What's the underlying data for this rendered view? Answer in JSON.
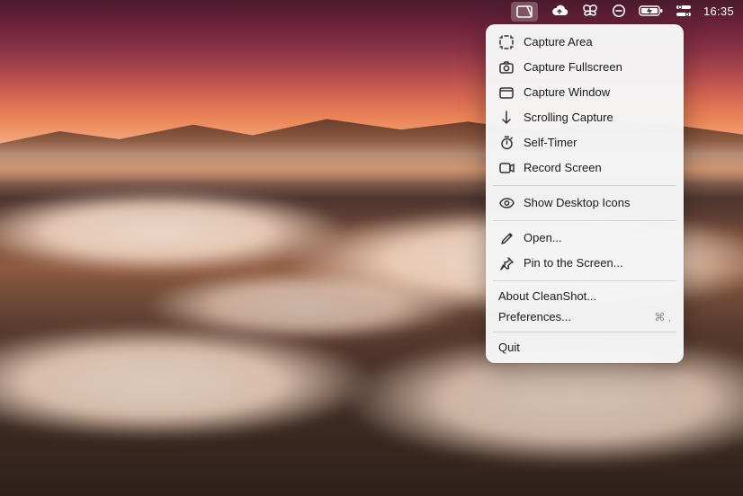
{
  "menubar": {
    "time": "16:35",
    "items": [
      {
        "name": "cleanshot",
        "active": true
      },
      {
        "name": "cloud"
      },
      {
        "name": "butterfly"
      },
      {
        "name": "do-not-disturb"
      },
      {
        "name": "battery"
      },
      {
        "name": "control-center"
      }
    ]
  },
  "menu": {
    "section1": [
      {
        "key": "capture_area",
        "label": "Capture Area",
        "icon": "crop"
      },
      {
        "key": "capture_fullscreen",
        "label": "Capture Fullscreen",
        "icon": "camera"
      },
      {
        "key": "capture_window",
        "label": "Capture Window",
        "icon": "window"
      },
      {
        "key": "scrolling_capture",
        "label": "Scrolling Capture",
        "icon": "scroll-down"
      },
      {
        "key": "self_timer",
        "label": "Self-Timer",
        "icon": "timer"
      },
      {
        "key": "record_screen",
        "label": "Record Screen",
        "icon": "video"
      }
    ],
    "section2": [
      {
        "key": "show_desktop_icons",
        "label": "Show Desktop Icons",
        "icon": "eye"
      }
    ],
    "section3": [
      {
        "key": "open",
        "label": "Open...",
        "icon": "pencil"
      },
      {
        "key": "pin",
        "label": "Pin to the Screen...",
        "icon": "pin"
      }
    ],
    "section4": [
      {
        "key": "about",
        "label": "About CleanShot..."
      },
      {
        "key": "prefs",
        "label": "Preferences...",
        "shortcut": "⌘ ,"
      }
    ],
    "section5": [
      {
        "key": "quit",
        "label": "Quit"
      }
    ]
  }
}
